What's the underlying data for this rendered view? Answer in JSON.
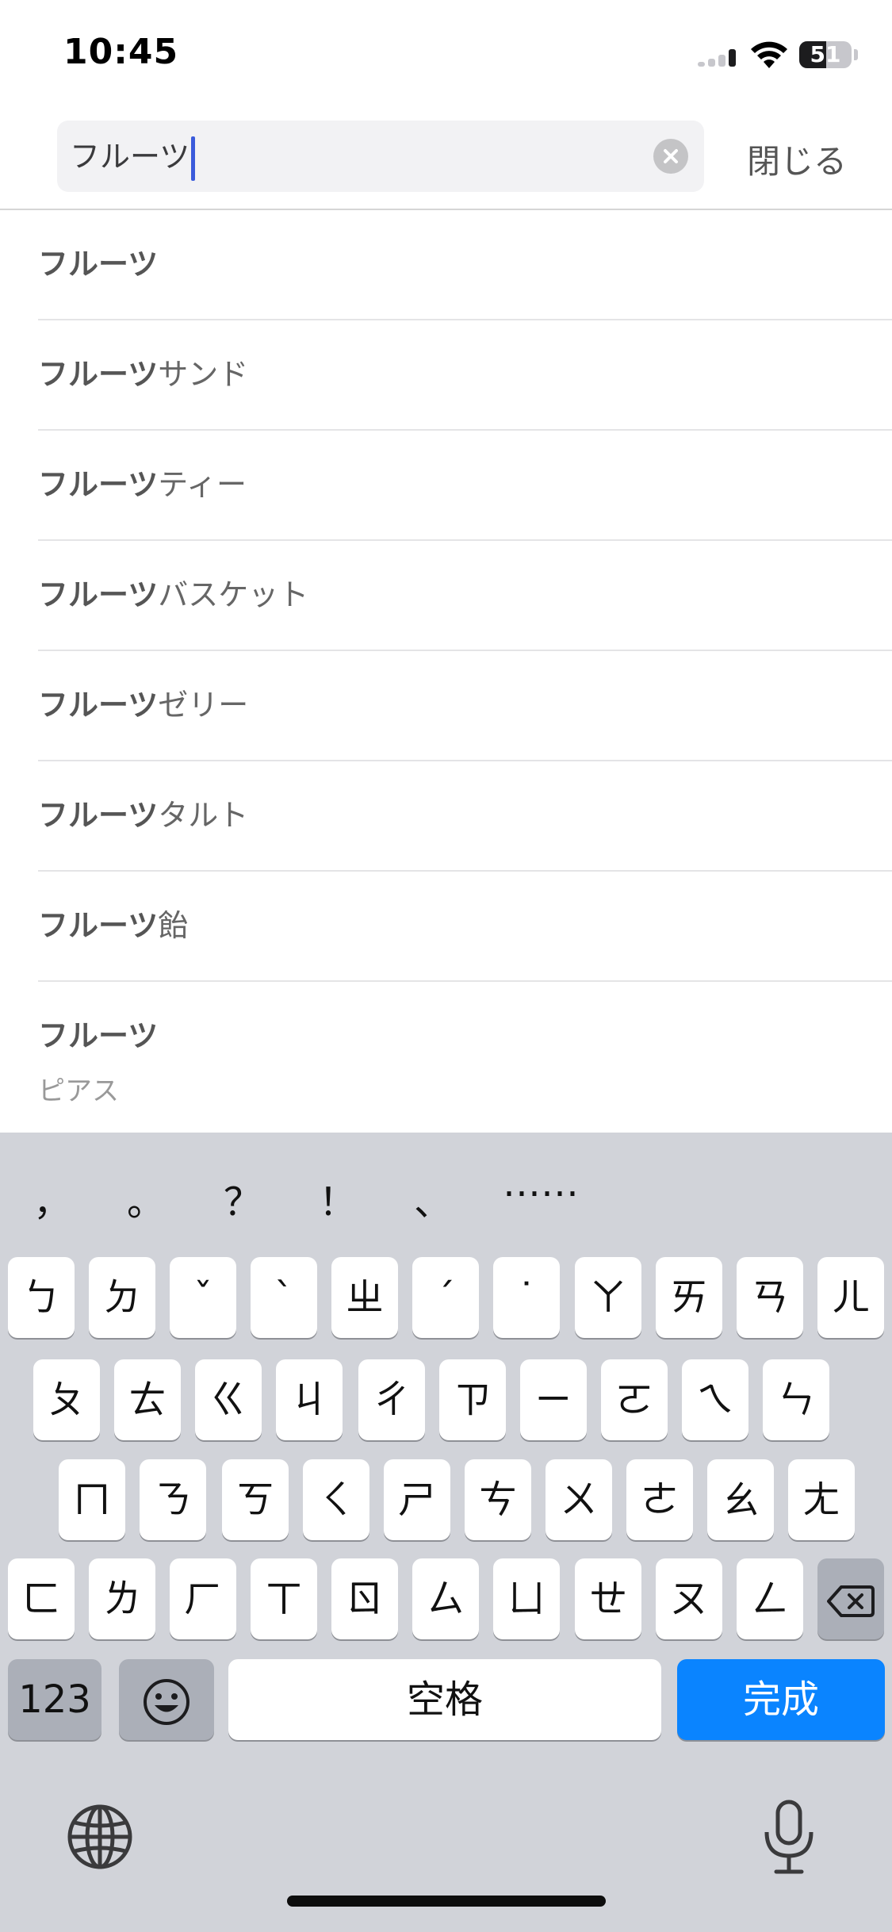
{
  "status": {
    "time": "10:45",
    "battery": "51",
    "battery_level": 0.51
  },
  "search": {
    "query": "フルーツ",
    "close_label": "閉じる"
  },
  "suggestions": [
    {
      "bold": "フルーツ",
      "rest": ""
    },
    {
      "bold": "フルーツ",
      "rest": "サンド"
    },
    {
      "bold": "フルーツ",
      "rest": "ティー"
    },
    {
      "bold": "フルーツ",
      "rest": "バスケット"
    },
    {
      "bold": "フルーツ",
      "rest": "ゼリー"
    },
    {
      "bold": "フルーツ",
      "rest": "タルト"
    },
    {
      "bold": "フルーツ",
      "rest": "飴"
    },
    {
      "bold": "フルーツ",
      "rest": "",
      "sub": "ピアス"
    }
  ],
  "keyboard": {
    "candidates": [
      "，",
      "。",
      "？",
      "！",
      "、",
      "⋯⋯"
    ],
    "row1": [
      "ㄅ",
      "ㄉ",
      "ˇ",
      "ˋ",
      "ㄓ",
      "ˊ",
      "˙",
      "ㄚ",
      "ㄞ",
      "ㄢ",
      "ㄦ"
    ],
    "row2": [
      "ㄆ",
      "ㄊ",
      "ㄍ",
      "ㄐ",
      "ㄔ",
      "ㄗ",
      "ㄧ",
      "ㄛ",
      "ㄟ",
      "ㄣ"
    ],
    "row3": [
      "ㄇ",
      "ㄋ",
      "ㄎ",
      "ㄑ",
      "ㄕ",
      "ㄘ",
      "ㄨ",
      "ㄜ",
      "ㄠ",
      "ㄤ"
    ],
    "row4": [
      "ㄈ",
      "ㄌ",
      "ㄏ",
      "ㄒ",
      "ㄖ",
      "ㄙ",
      "ㄩ",
      "ㄝ",
      "ㄡ",
      "ㄥ"
    ],
    "numbers_label": "123",
    "space_label": "空格",
    "done_label": "完成",
    "delete_icon": "delete-backspace-icon",
    "emoji_icon": "emoji-icon",
    "globe_icon": "globe-icon",
    "mic_icon": "microphone-icon"
  }
}
